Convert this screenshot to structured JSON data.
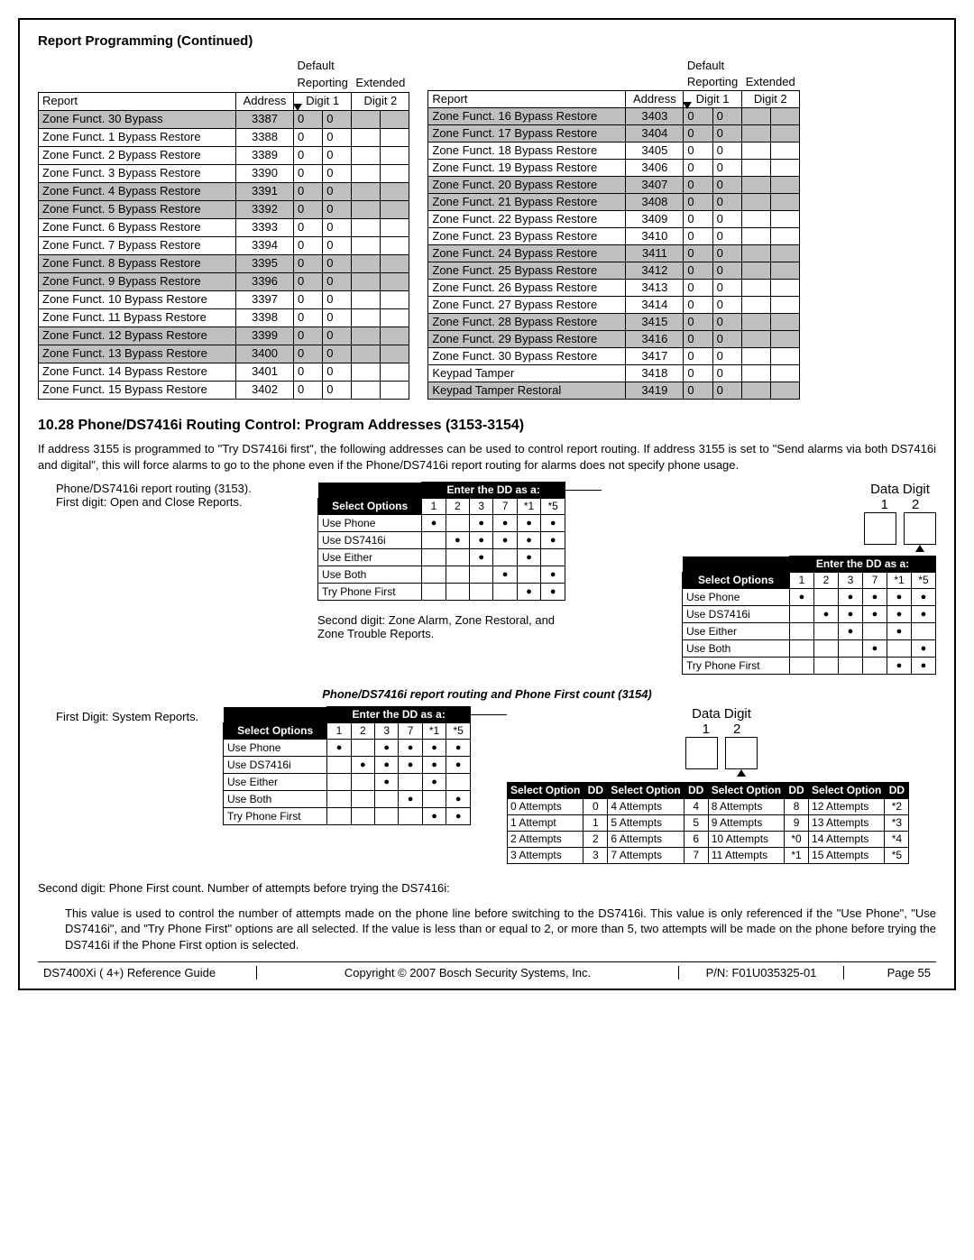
{
  "section_title": "Report Programming (Continued)",
  "table_headers": {
    "default": "Default",
    "report": "Report",
    "address": "Address",
    "reporting": "Reporting",
    "extended": "Extended",
    "digit1": "Digit 1",
    "digit2": "Digit 2"
  },
  "left_rows": [
    {
      "r": "Zone Funct. 30 Bypass",
      "a": "3387",
      "d": "00",
      "s": true
    },
    {
      "r": "Zone Funct. 1 Bypass Restore",
      "a": "3388",
      "d": "00",
      "s": false
    },
    {
      "r": "Zone Funct. 2 Bypass Restore",
      "a": "3389",
      "d": "00",
      "s": false
    },
    {
      "r": "Zone Funct. 3 Bypass Restore",
      "a": "3390",
      "d": "00",
      "s": false
    },
    {
      "r": "Zone Funct. 4 Bypass Restore",
      "a": "3391",
      "d": "00",
      "s": true
    },
    {
      "r": "Zone Funct. 5 Bypass Restore",
      "a": "3392",
      "d": "00",
      "s": true
    },
    {
      "r": "Zone Funct. 6 Bypass Restore",
      "a": "3393",
      "d": "00",
      "s": false
    },
    {
      "r": "Zone Funct. 7 Bypass Restore",
      "a": "3394",
      "d": "00",
      "s": false
    },
    {
      "r": "Zone Funct. 8 Bypass Restore",
      "a": "3395",
      "d": "00",
      "s": true
    },
    {
      "r": "Zone Funct. 9 Bypass Restore",
      "a": "3396",
      "d": "00",
      "s": true
    },
    {
      "r": "Zone Funct. 10 Bypass Restore",
      "a": "3397",
      "d": "00",
      "s": false
    },
    {
      "r": "Zone Funct. 11 Bypass Restore",
      "a": "3398",
      "d": "00",
      "s": false
    },
    {
      "r": "Zone Funct. 12 Bypass Restore",
      "a": "3399",
      "d": "00",
      "s": true
    },
    {
      "r": "Zone Funct. 13 Bypass Restore",
      "a": "3400",
      "d": "00",
      "s": true
    },
    {
      "r": "Zone Funct. 14 Bypass Restore",
      "a": "3401",
      "d": "00",
      "s": false
    },
    {
      "r": "Zone Funct. 15 Bypass Restore",
      "a": "3402",
      "d": "00",
      "s": false
    }
  ],
  "right_rows": [
    {
      "r": "Zone Funct. 16 Bypass Restore",
      "a": "3403",
      "d": "00",
      "s": true
    },
    {
      "r": "Zone Funct. 17 Bypass Restore",
      "a": "3404",
      "d": "00",
      "s": true
    },
    {
      "r": "Zone Funct. 18 Bypass Restore",
      "a": "3405",
      "d": "00",
      "s": false
    },
    {
      "r": "Zone Funct. 19 Bypass Restore",
      "a": "3406",
      "d": "00",
      "s": false
    },
    {
      "r": "Zone Funct. 20 Bypass Restore",
      "a": "3407",
      "d": "00",
      "s": true
    },
    {
      "r": "Zone Funct. 21 Bypass Restore",
      "a": "3408",
      "d": "00",
      "s": true
    },
    {
      "r": "Zone Funct. 22 Bypass Restore",
      "a": "3409",
      "d": "00",
      "s": false
    },
    {
      "r": "Zone Funct. 23 Bypass Restore",
      "a": "3410",
      "d": "00",
      "s": false
    },
    {
      "r": "Zone Funct. 24 Bypass Restore",
      "a": "3411",
      "d": "00",
      "s": true
    },
    {
      "r": "Zone Funct. 25 Bypass Restore",
      "a": "3412",
      "d": "00",
      "s": true
    },
    {
      "r": "Zone Funct. 26 Bypass Restore",
      "a": "3413",
      "d": "00",
      "s": false
    },
    {
      "r": "Zone Funct. 27 Bypass Restore",
      "a": "3414",
      "d": "00",
      "s": false
    },
    {
      "r": "Zone Funct. 28 Bypass Restore",
      "a": "3415",
      "d": "00",
      "s": true
    },
    {
      "r": "Zone Funct. 29 Bypass Restore",
      "a": "3416",
      "d": "00",
      "s": true
    },
    {
      "r": "Zone Funct. 30 Bypass Restore",
      "a": "3417",
      "d": "00",
      "s": false
    },
    {
      "r": "Keypad Tamper",
      "a": "3418",
      "d": "00",
      "s": false
    },
    {
      "r": "Keypad Tamper Restoral",
      "a": "3419",
      "d": "00",
      "s": true
    }
  ],
  "heading_1028": "10.28  Phone/DS7416i Routing Control: Program Addresses (3153-3154)",
  "para1": "If address 3155 is programmed to \"Try DS7416i first\", the following addresses can be used to control report routing. If address 3155 is set to \"Send alarms via both DS7416i and digital\", this will force alarms to go to the phone even if the Phone/DS7416i report routing for alarms does not specify phone usage.",
  "intro_line1": "Phone/DS7416i report routing (3153).",
  "intro_line2": "First digit: Open and Close Reports.",
  "data_digit_label": "Data Digit",
  "dd_1": "1",
  "dd_2": "2",
  "enter_dd": "Enter the DD as a:",
  "select_options": "Select Options",
  "opt_cols": [
    "1",
    "2",
    "3",
    "7",
    "*1",
    "*5"
  ],
  "opt_rows": [
    {
      "n": "Use Phone",
      "d": [
        1,
        0,
        1,
        1,
        1,
        1
      ]
    },
    {
      "n": "Use DS7416i",
      "d": [
        0,
        1,
        1,
        1,
        1,
        1
      ]
    },
    {
      "n": "Use Either",
      "d": [
        0,
        0,
        1,
        0,
        1,
        0
      ]
    },
    {
      "n": "Use Both",
      "d": [
        0,
        0,
        0,
        1,
        0,
        1
      ]
    },
    {
      "n": "Try Phone First",
      "d": [
        0,
        0,
        0,
        0,
        1,
        1
      ]
    }
  ],
  "second_digit_note": "Second digit:  Zone Alarm, Zone Restoral, and Zone Trouble Reports.",
  "routing_3154_title": "Phone/DS7416i report routing and Phone First count (3154)",
  "first_digit_system": "First Digit: System Reports.",
  "select_option_hdr": "Select Option",
  "dd_hdr": "DD",
  "attempts": [
    [
      "0 Attempts",
      "0",
      "4 Attempts",
      "4",
      "8 Attempts",
      "8",
      "12 Attempts",
      "*2"
    ],
    [
      "1 Attempt",
      "1",
      "5 Attempts",
      "5",
      "9 Attempts",
      "9",
      "13 Attempts",
      "*3"
    ],
    [
      "2 Attempts",
      "2",
      "6 Attempts",
      "6",
      "10 Attempts",
      "*0",
      "14 Attempts",
      "*4"
    ],
    [
      "3 Attempts",
      "3",
      "7 Attempts",
      "7",
      "11 Attempts",
      "*1",
      "15 Attempts",
      "*5"
    ]
  ],
  "second_digit_count": "Second digit:  Phone First count. Number of attempts before trying the DS7416i:",
  "final_para": "This value is used to control the number of attempts made on the phone line before switching to the DS7416i. This value is only referenced if the \"Use Phone\", \"Use DS7416i\", and \"Try Phone First\" options are all selected. If the value is less than or equal to 2, or more than 5, two attempts will be made on the phone before trying the DS7416i if the Phone First option is selected.",
  "footer": {
    "guide": "DS7400Xi ( 4+) Reference Guide",
    "copyright": "Copyright © 2007 Bosch Security Systems, Inc.",
    "pn": "P/N: F01U035325-01",
    "page": "Page 55"
  }
}
